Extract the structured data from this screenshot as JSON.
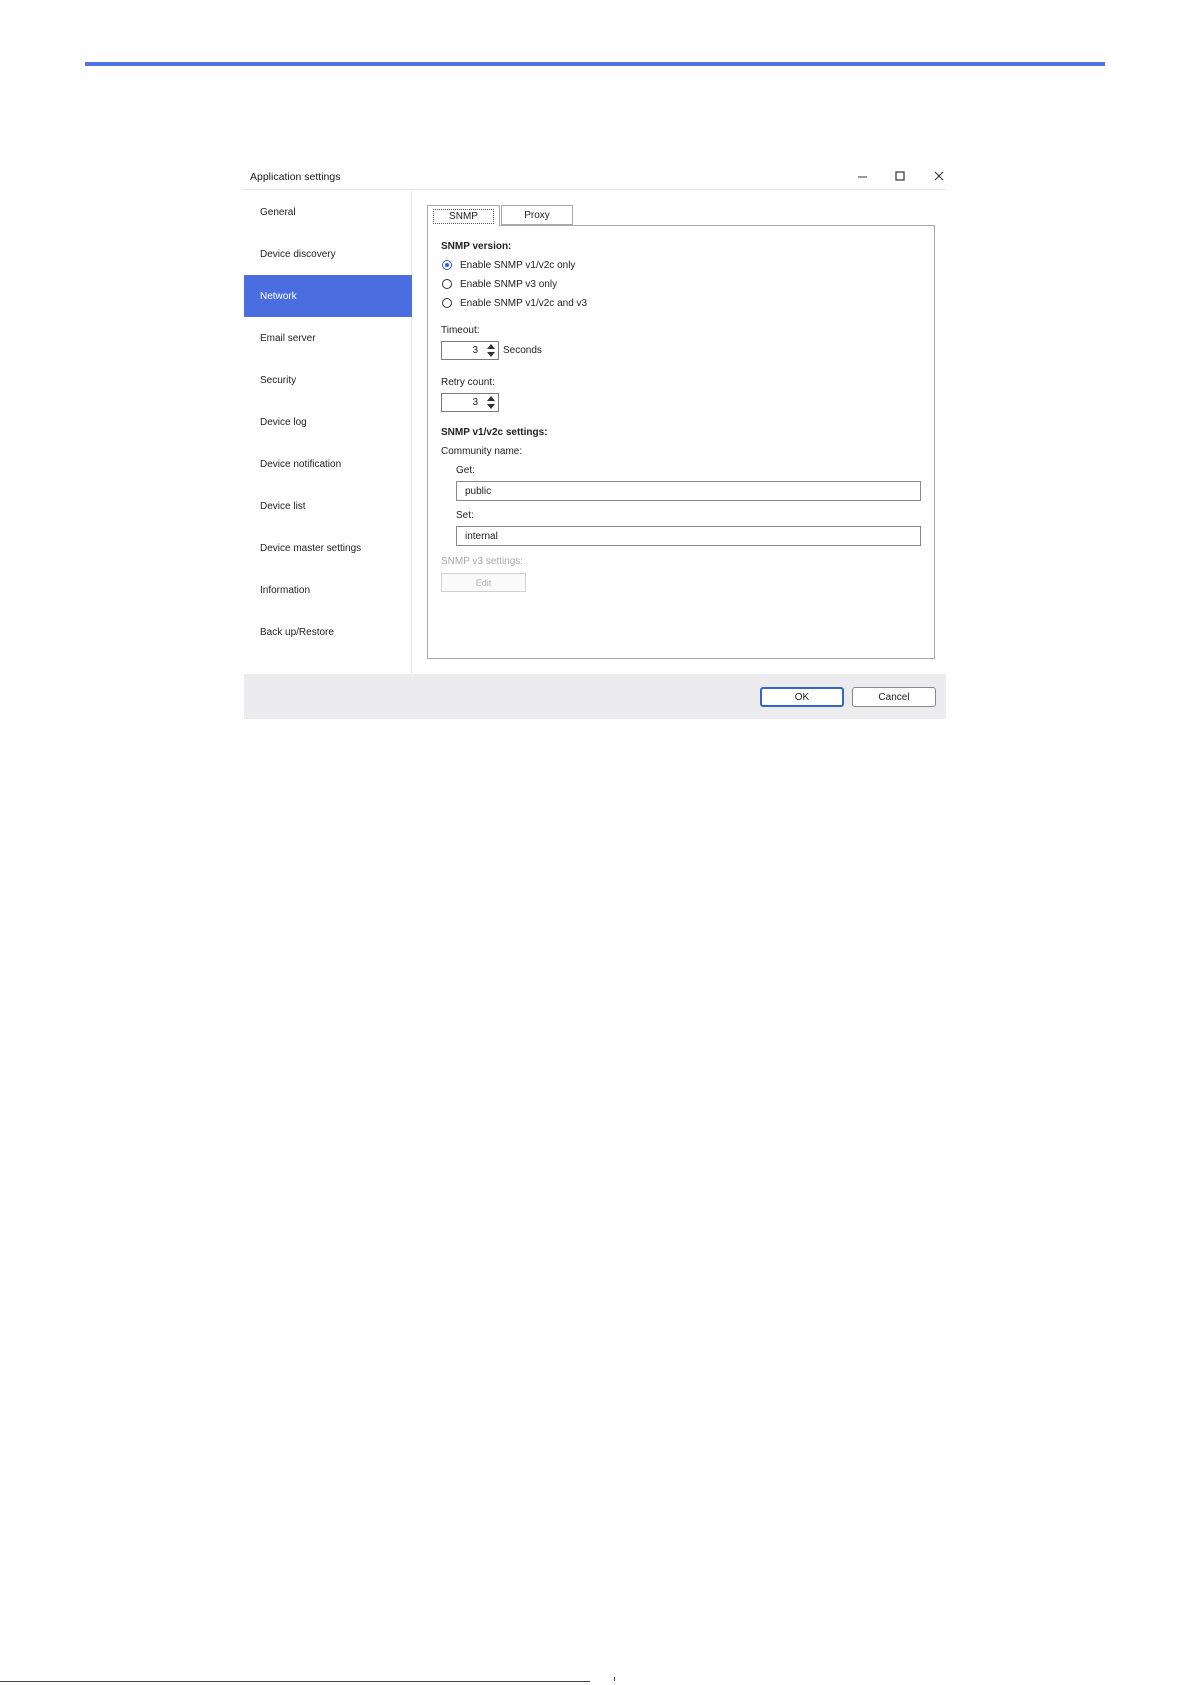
{
  "window": {
    "title": "Application settings"
  },
  "sidebar": {
    "items": [
      {
        "label": "General",
        "active": false
      },
      {
        "label": "Device discovery",
        "active": false
      },
      {
        "label": "Network",
        "active": true
      },
      {
        "label": "Email server",
        "active": false
      },
      {
        "label": "Security",
        "active": false
      },
      {
        "label": "Device log",
        "active": false
      },
      {
        "label": "Device notification",
        "active": false
      },
      {
        "label": "Device list",
        "active": false
      },
      {
        "label": "Device master settings",
        "active": false
      },
      {
        "label": "Information",
        "active": false
      },
      {
        "label": "Back up/Restore",
        "active": false
      }
    ]
  },
  "tabs": [
    {
      "label": "SNMP",
      "active": true
    },
    {
      "label": "Proxy",
      "active": false
    }
  ],
  "snmp": {
    "version_heading": "SNMP version:",
    "version_options": [
      {
        "label": "Enable SNMP v1/v2c only",
        "checked": true
      },
      {
        "label": "Enable SNMP v3 only",
        "checked": false
      },
      {
        "label": "Enable SNMP v1/v2c and v3",
        "checked": false
      }
    ],
    "timeout_label": "Timeout:",
    "timeout_value": "3",
    "timeout_unit": "Seconds",
    "retry_label": "Retry count:",
    "retry_value": "3",
    "v1v2c_heading": "SNMP v1/v2c settings:",
    "community_label": "Community name:",
    "get_label": "Get:",
    "get_value": "public",
    "set_label": "Set:",
    "set_value": "internal",
    "v3_heading": "SNMP v3 settings:",
    "v3_edit_label": "Edit"
  },
  "footer": {
    "ok_label": "OK",
    "cancel_label": "Cancel"
  },
  "colors": {
    "accent": "#4a6ee0",
    "page_rule": "#4f74e3",
    "footer_bg": "#ececef"
  }
}
